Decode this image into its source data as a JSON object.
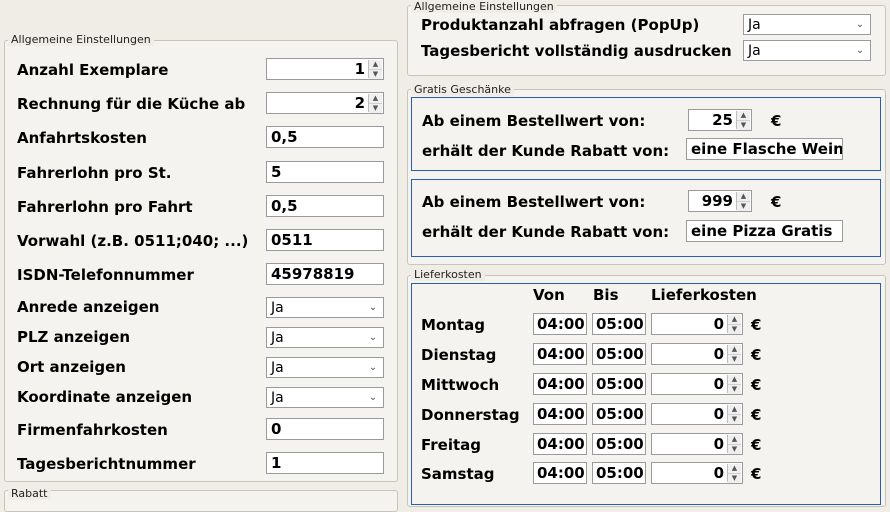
{
  "left_group": {
    "title": "Allgemeine Einstellungen",
    "rows": [
      {
        "label": "Anzahl Exemplare",
        "value": "1"
      },
      {
        "label": "Rechnung für die Küche ab",
        "value": "2"
      },
      {
        "label": "Anfahrtskosten",
        "value": "0,5"
      },
      {
        "label": "Fahrerlohn pro St.",
        "value": "5"
      },
      {
        "label": "Fahrerlohn pro Fahrt",
        "value": "0,5"
      },
      {
        "label": "Vorwahl (z.B. 0511;040; ...)",
        "value": "0511"
      },
      {
        "label": "ISDN-Telefonnummer",
        "value": "45978819"
      },
      {
        "label": "Anrede anzeigen",
        "value": "Ja"
      },
      {
        "label": "PLZ anzeigen",
        "value": "Ja"
      },
      {
        "label": "Ort anzeigen",
        "value": "Ja"
      },
      {
        "label": "Koordinate anzeigen",
        "value": "Ja"
      },
      {
        "label": "Firmenfahrkosten",
        "value": "0"
      },
      {
        "label": "Tagesberichtnummer",
        "value": "1"
      }
    ],
    "next_group_title": "Rabatt"
  },
  "right_general": {
    "title": "Allgemeine Einstellungen",
    "rows": [
      {
        "label": "Produktanzahl abfragen (PopUp)",
        "value": "Ja"
      },
      {
        "label": "Tagesbericht vollständig ausdrucken",
        "value": "Ja"
      }
    ]
  },
  "gifts": {
    "title": "Gratis Geschänke",
    "boxes": [
      {
        "order_label": "Ab einem Bestellwert von:",
        "order_value": "25",
        "currency": "€",
        "discount_label": "erhält der Kunde Rabatt von:",
        "discount_value": "eine Flasche Wein"
      },
      {
        "order_label": "Ab einem Bestellwert von:",
        "order_value": "999",
        "currency": "€",
        "discount_label": "erhält der Kunde Rabatt von:",
        "discount_value": "eine Pizza Gratis"
      }
    ]
  },
  "delivery": {
    "title": "Lieferkosten",
    "col_from": "Von",
    "col_to": "Bis",
    "col_cost": "Lieferkosten",
    "currency": "€",
    "days": [
      {
        "day": "Montag",
        "from": "04:00",
        "to": "05:00",
        "cost": "0"
      },
      {
        "day": "Dienstag",
        "from": "04:00",
        "to": "05:00",
        "cost": "0"
      },
      {
        "day": "Mittwoch",
        "from": "04:00",
        "to": "05:00",
        "cost": "0"
      },
      {
        "day": "Donnerstag",
        "from": "04:00",
        "to": "05:00",
        "cost": "0"
      },
      {
        "day": "Freitag",
        "from": "04:00",
        "to": "05:00",
        "cost": "0"
      },
      {
        "day": "Samstag",
        "from": "04:00",
        "to": "05:00",
        "cost": "0"
      }
    ]
  },
  "icons": {
    "spin_up": "▲",
    "spin_down": "▼",
    "dropdown": "⌄"
  }
}
